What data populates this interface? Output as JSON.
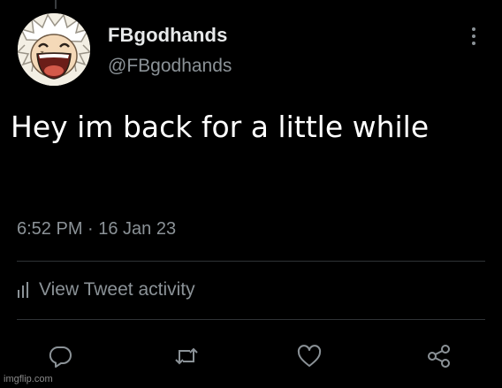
{
  "tweet": {
    "display_name": "FBgodhands",
    "handle": "@FBgodhands",
    "text": "Hey im back for a little while",
    "timestamp": "6:52 PM · 16 Jan 23",
    "activity_label": "View Tweet activity"
  },
  "icons": {
    "more": "more-vertical-icon",
    "activity": "bar-chart-icon",
    "reply": "reply-icon",
    "retweet": "retweet-icon",
    "like": "heart-icon",
    "share": "share-icon"
  },
  "colors": {
    "background": "#000000",
    "primary_text": "#e7e9ea",
    "secondary_text": "#8b9297",
    "divider": "#2f3336"
  },
  "watermark": "imgflip.com"
}
